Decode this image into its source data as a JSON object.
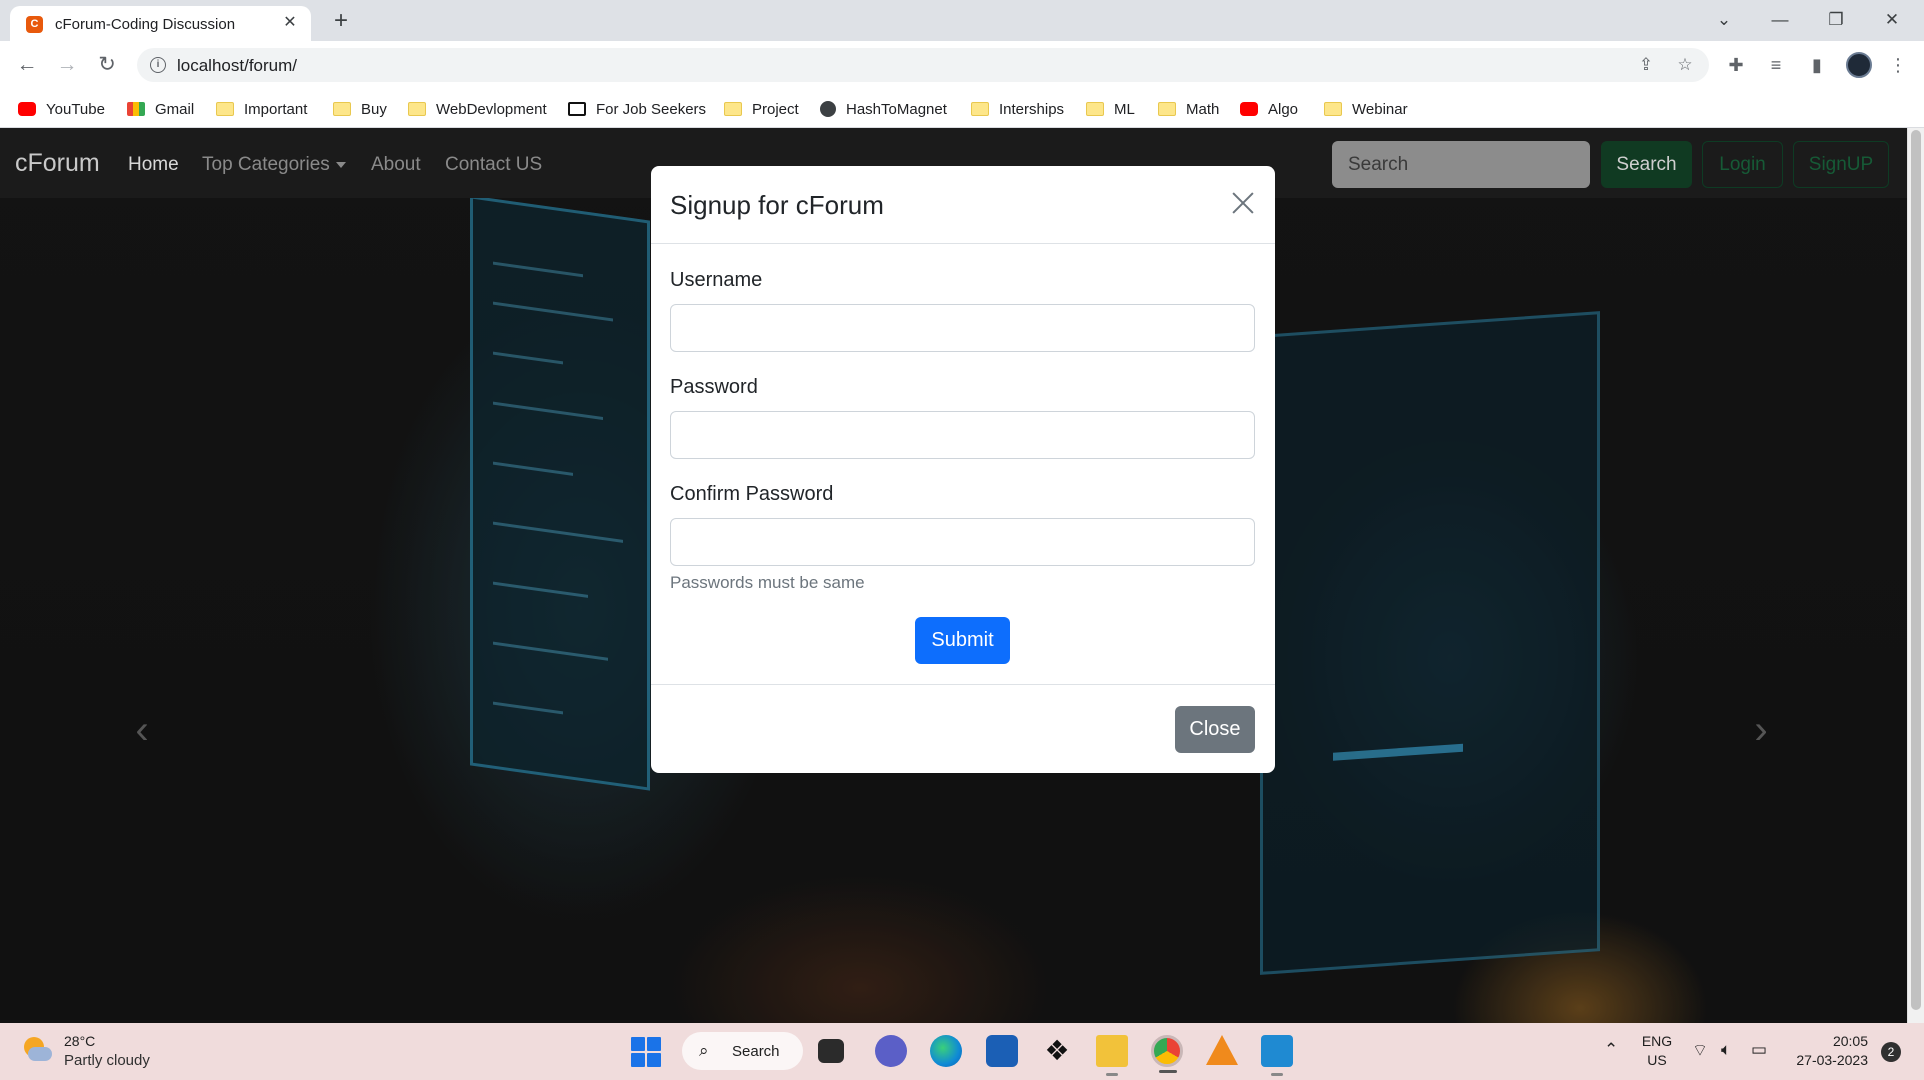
{
  "browser": {
    "tab_title": "cForum-Coding Discussion",
    "url": "localhost/forum/",
    "bookmarks": [
      {
        "label": "YouTube",
        "icon": "youtube-icon"
      },
      {
        "label": "Gmail",
        "icon": "gmail-icon"
      },
      {
        "label": "Important",
        "icon": "folder-icon"
      },
      {
        "label": "Buy",
        "icon": "folder-icon"
      },
      {
        "label": "WebDevlopment",
        "icon": "folder-icon"
      },
      {
        "label": "For Job Seekers",
        "icon": "notion-icon"
      },
      {
        "label": "Project",
        "icon": "folder-icon"
      },
      {
        "label": "HashToMagnet",
        "icon": "globe-icon"
      },
      {
        "label": "Interships",
        "icon": "folder-icon"
      },
      {
        "label": "ML",
        "icon": "folder-icon"
      },
      {
        "label": "Math",
        "icon": "folder-icon"
      },
      {
        "label": "Algo",
        "icon": "youtube-icon"
      },
      {
        "label": "Webinar",
        "icon": "folder-icon"
      }
    ]
  },
  "navbar": {
    "brand": "cForum",
    "links": [
      "Home",
      "Top Categories",
      "About",
      "Contact US"
    ],
    "search_placeholder": "Search",
    "search_button": "Search",
    "login_button": "Login",
    "signup_button": "SignUP"
  },
  "modal": {
    "title": "Signup for cForum",
    "username_label": "Username",
    "password_label": "Password",
    "confirm_label": "Confirm Password",
    "help_text": "Passwords must be same",
    "submit_button": "Submit",
    "close_button": "Close"
  },
  "taskbar": {
    "temperature": "28°C",
    "weather": "Partly cloudy",
    "search_label": "Search",
    "lang": "ENG",
    "region": "US",
    "time": "20:05",
    "date": "27-03-2023",
    "notifications": "2"
  },
  "colors": {
    "primary": "#0d6efd",
    "secondary": "#6c757d",
    "navbar": "#1b1b1b",
    "success_dark": "#103a22"
  }
}
